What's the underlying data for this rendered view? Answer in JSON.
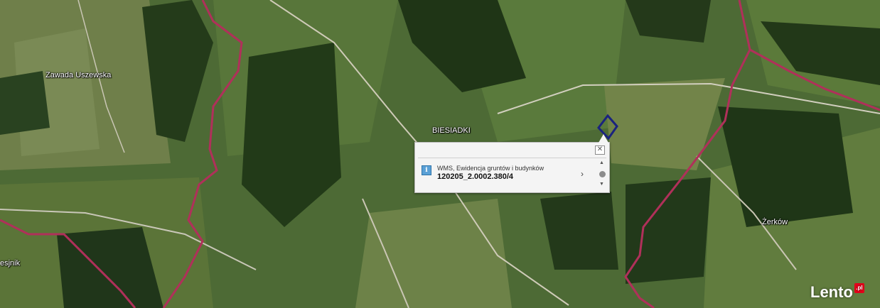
{
  "map": {
    "places": [
      {
        "label": "Zawada Uszewska"
      },
      {
        "label": "BIESIADKI"
      },
      {
        "label": "Żerków"
      },
      {
        "label": "esjnik"
      }
    ]
  },
  "popup": {
    "close_icon": "close-icon",
    "info_icon": "info-icon",
    "layer_name": "WMS, Ewidencja gruntów i budynków",
    "parcel_id": "120205_2.0002.380/4",
    "next_icon": "chevron-right-icon",
    "scroll_up_icon": "triangle-up-icon",
    "scroll_down_icon": "triangle-down-icon"
  },
  "watermark": {
    "brand": "Lento",
    "tld": ".pl"
  },
  "colors": {
    "boundary": "#b0305a",
    "parcel_outline": "#1a237e",
    "popup_bg": "#f4f4f4"
  }
}
